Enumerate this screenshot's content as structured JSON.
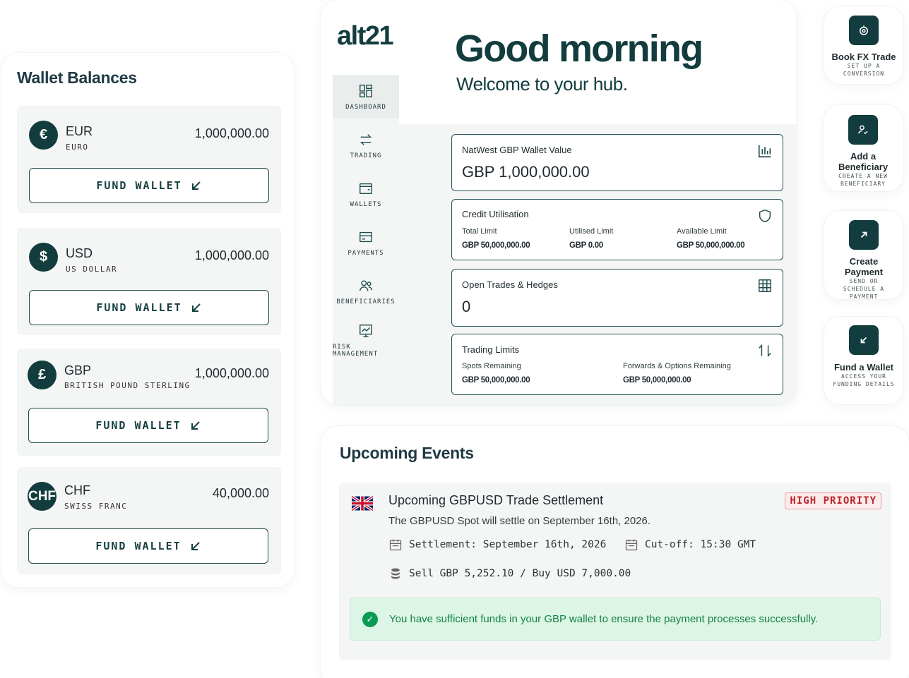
{
  "wallet": {
    "title": "Wallet Balances",
    "fund_label": "FUND WALLET",
    "items": [
      {
        "symbol": "€",
        "code": "EUR",
        "name": "EURO",
        "amount": "1,000,000.00"
      },
      {
        "symbol": "$",
        "code": "USD",
        "name": "US DOLLAR",
        "amount": "1,000,000.00"
      },
      {
        "symbol": "£",
        "code": "GBP",
        "name": "BRITISH POUND STERLING",
        "amount": "1,000,000.00"
      },
      {
        "symbol": "CHF",
        "code": "CHF",
        "name": "SWISS FRANC",
        "amount": "40,000.00"
      }
    ]
  },
  "brand": {
    "logo": "alt21",
    "accent": "#123c3d"
  },
  "nav": [
    {
      "label": "DASHBOARD",
      "icon": "dashboard-icon"
    },
    {
      "label": "TRADING",
      "icon": "transfer-arrows-icon"
    },
    {
      "label": "WALLETS",
      "icon": "wallet-icon"
    },
    {
      "label": "PAYMENTS",
      "icon": "card-icon"
    },
    {
      "label": "BENEFICIARIES",
      "icon": "users-icon"
    },
    {
      "label": "RISK MANAGEMENT",
      "icon": "chart-board-icon"
    }
  ],
  "header": {
    "greeting": "Good morning",
    "welcome": "Welcome to your hub."
  },
  "cards": {
    "wallet_value": {
      "title": "NatWest GBP Wallet Value",
      "value": "GBP 1,000,000.00"
    },
    "credit": {
      "title": "Credit Utilisation",
      "cols": [
        {
          "label": "Total Limit",
          "value": "GBP 50,000,000.00"
        },
        {
          "label": "Utilised Limit",
          "value": "GBP 0.00"
        },
        {
          "label": "Available Limit",
          "value": "GBP 50,000,000.00"
        }
      ]
    },
    "open_trades": {
      "title": "Open Trades & Hedges",
      "value": "0"
    },
    "trading_limits": {
      "title": "Trading Limits",
      "cols": [
        {
          "label": "Spots Remaining",
          "value": "GBP 50,000,000.00"
        },
        {
          "label": "Forwards & Options Remaining",
          "value": "GBP 50,000,000.00"
        }
      ]
    }
  },
  "quick_actions": [
    {
      "title": "Book FX Trade",
      "sub": "SET UP A CONVERSION",
      "icon": "fx-icon"
    },
    {
      "title": "Add a Beneficiary",
      "sub": "CREATE A NEW BENEFICIARY",
      "icon": "add-user-icon"
    },
    {
      "title": "Create Payment",
      "sub": "SEND OR SCHEDULE A PAYMENT",
      "icon": "arrow-up-right-icon"
    },
    {
      "title": "Fund a Wallet",
      "sub": "ACCESS YOUR FUNDING DETAILS",
      "icon": "arrow-down-left-icon"
    }
  ],
  "events": {
    "title": "Upcoming Events",
    "item": {
      "title": "Upcoming GBPUSD Trade Settlement",
      "badge": "HIGH PRIORITY",
      "description": "The GBPUSD Spot will settle on September 16th, 2026.",
      "settlement": "Settlement: September 16th, 2026",
      "cutoff": "Cut-off: 15:30 GMT",
      "trade": "Sell GBP 5,252.10 / Buy USD 7,000.00",
      "alert": "You have sufficient funds in your GBP wallet to ensure the payment processes successfully."
    }
  }
}
